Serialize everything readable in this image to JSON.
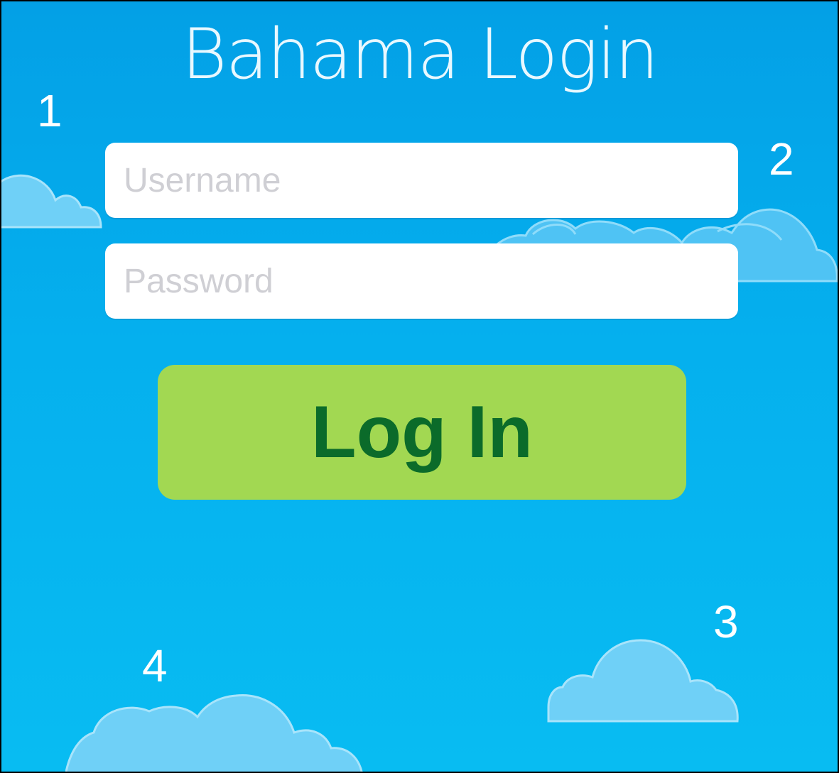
{
  "app": {
    "title": "Bahama Login"
  },
  "form": {
    "username": {
      "value": "",
      "placeholder": "Username"
    },
    "password": {
      "value": "",
      "placeholder": "Password"
    },
    "login_label": "Log In"
  },
  "markers": [
    "1",
    "2",
    "3",
    "4"
  ],
  "colors": {
    "sky_top": "#03a0e6",
    "sky_bottom": "#08bcf2",
    "cloud": "#6fd0f7",
    "button_bg": "#a2d852",
    "button_text": "#0b6b2a",
    "title_text": "#e8f8ff"
  }
}
